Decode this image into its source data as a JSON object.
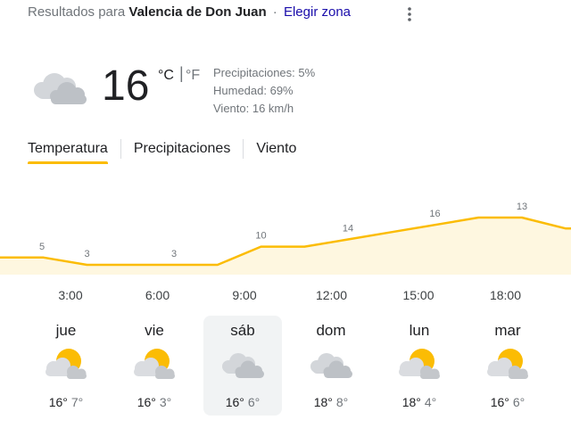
{
  "header": {
    "prefix": "Resultados para",
    "location": "Valencia de Don Juan",
    "separator": "·",
    "change_zone": "Elegir zona"
  },
  "current": {
    "icon": "cloudy-icon",
    "temperature": "16",
    "unit_c": "°C",
    "unit_sep": "|",
    "unit_f": "°F",
    "precipitation": "Precipitaciones: 5%",
    "humidity": "Humedad: 69%",
    "wind": "Viento: 16 km/h"
  },
  "tabs": [
    {
      "label": "Temperatura",
      "active": true
    },
    {
      "label": "Precipitaciones",
      "active": false
    },
    {
      "label": "Viento",
      "active": false
    }
  ],
  "chart_data": {
    "type": "area",
    "x": [
      "00:00",
      "01:30",
      "3:00",
      "4:30",
      "6:00",
      "7:30",
      "9:00",
      "10:30",
      "12:00",
      "13:30",
      "15:00",
      "16:30",
      "18:00",
      "19:30"
    ],
    "values": [
      5,
      5,
      3,
      3,
      3,
      3,
      8,
      8,
      10,
      12,
      14,
      16,
      16,
      13
    ],
    "data_labels": [
      {
        "x_index": 0,
        "text": "5"
      },
      {
        "x_index": 2,
        "text": "3"
      },
      {
        "x_index": 4,
        "text": "3"
      },
      {
        "x_index": 6,
        "text": "10"
      },
      {
        "x_index": 8,
        "text": "14"
      },
      {
        "x_index": 10,
        "text": "16"
      },
      {
        "x_index": 12,
        "text": "13"
      }
    ],
    "xtick_labels": [
      "3:00",
      "6:00",
      "9:00",
      "12:00",
      "15:00",
      "18:00"
    ],
    "line_color": "#fbbc04",
    "fill_color": "#fef7e0"
  },
  "days": [
    {
      "name": "jue",
      "icon": "partly-cloudy-icon",
      "high": "16°",
      "low": "7°",
      "selected": false
    },
    {
      "name": "vie",
      "icon": "partly-cloudy-icon",
      "high": "16°",
      "low": "3°",
      "selected": false
    },
    {
      "name": "sáb",
      "icon": "cloudy-icon",
      "high": "16°",
      "low": "6°",
      "selected": true
    },
    {
      "name": "dom",
      "icon": "cloudy-icon",
      "high": "18°",
      "low": "8°",
      "selected": false
    },
    {
      "name": "lun",
      "icon": "partly-cloudy-icon",
      "high": "18°",
      "low": "4°",
      "selected": false
    },
    {
      "name": "mar",
      "icon": "partly-cloudy-icon",
      "high": "16°",
      "low": "6°",
      "selected": false
    }
  ]
}
